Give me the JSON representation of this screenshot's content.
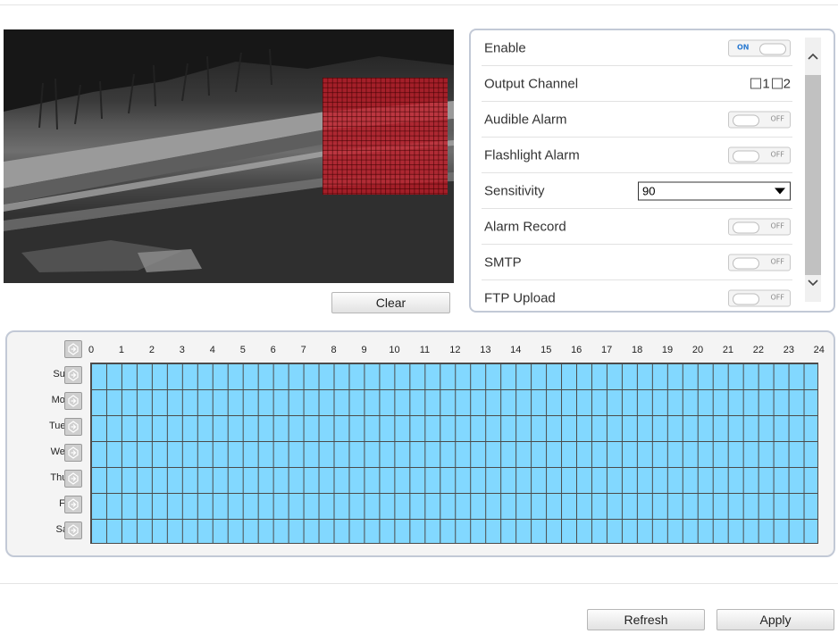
{
  "video": {
    "clear_label": "Clear"
  },
  "settings": {
    "enable": {
      "label": "Enable",
      "state": "ON"
    },
    "output_channel": {
      "label": "Output Channel",
      "options": [
        "1",
        "2"
      ]
    },
    "audible_alarm": {
      "label": "Audible Alarm",
      "state": "OFF"
    },
    "flashlight_alarm": {
      "label": "Flashlight Alarm",
      "state": "OFF"
    },
    "sensitivity": {
      "label": "Sensitivity",
      "value": "90"
    },
    "alarm_record": {
      "label": "Alarm Record",
      "state": "OFF"
    },
    "smtp": {
      "label": "SMTP",
      "state": "OFF"
    },
    "ftp_upload": {
      "label": "FTP Upload",
      "state": "OFF"
    }
  },
  "schedule": {
    "hours": [
      "0",
      "1",
      "2",
      "3",
      "4",
      "5",
      "6",
      "7",
      "8",
      "9",
      "10",
      "11",
      "12",
      "13",
      "14",
      "15",
      "16",
      "17",
      "18",
      "19",
      "20",
      "21",
      "22",
      "23",
      "24"
    ],
    "days": [
      "Sun",
      "Mon",
      "Tues",
      "Wed",
      "Thur",
      "Fri",
      "Sat"
    ],
    "fill_color": "#82d8ff"
  },
  "footer": {
    "refresh_label": "Refresh",
    "apply_label": "Apply"
  }
}
